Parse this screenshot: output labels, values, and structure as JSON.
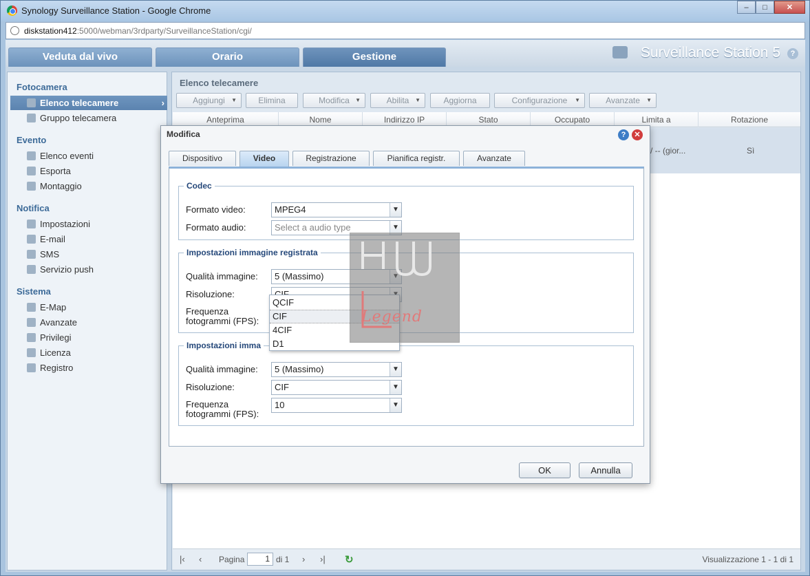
{
  "browser": {
    "title": "Synology Surveillance Station - Google Chrome",
    "url_host": "diskstation412",
    "url_rest": ":5000/webman/3rdparty/SurveillanceStation/cgi/"
  },
  "app": {
    "tabs": [
      "Veduta dal vivo",
      "Orario",
      "Gestione"
    ],
    "active_tab": "Gestione",
    "brand": "Surveillance Station 5"
  },
  "sidebar": {
    "sections": [
      {
        "title": "Fotocamera",
        "items": [
          {
            "label": "Elenco telecamere",
            "icon": "camera-list-icon",
            "active": true
          },
          {
            "label": "Gruppo telecamera",
            "icon": "camera-group-icon"
          }
        ]
      },
      {
        "title": "Evento",
        "items": [
          {
            "label": "Elenco eventi",
            "icon": "event-list-icon"
          },
          {
            "label": "Esporta",
            "icon": "export-icon"
          },
          {
            "label": "Montaggio",
            "icon": "montage-icon"
          }
        ]
      },
      {
        "title": "Notifica",
        "items": [
          {
            "label": "Impostazioni",
            "icon": "wrench-icon"
          },
          {
            "label": "E-mail",
            "icon": "email-icon"
          },
          {
            "label": "SMS",
            "icon": "sms-icon"
          },
          {
            "label": "Servizio push",
            "icon": "push-icon"
          }
        ]
      },
      {
        "title": "Sistema",
        "items": [
          {
            "label": "E-Map",
            "icon": "emap-icon"
          },
          {
            "label": "Avanzate",
            "icon": "advanced-icon"
          },
          {
            "label": "Privilegi",
            "icon": "users-icon"
          },
          {
            "label": "Licenza",
            "icon": "key-icon"
          },
          {
            "label": "Registro",
            "icon": "log-book-icon"
          }
        ]
      }
    ]
  },
  "main": {
    "title": "Elenco telecamere",
    "toolbar": [
      "Aggiungi",
      "Elimina",
      "Modifica",
      "Abilita",
      "Aggiorna",
      "Configurazione",
      "Avanzate"
    ],
    "columns": [
      "Anteprima",
      "Nome",
      "Indirizzo IP",
      "Stato",
      "Occupato",
      "Limita a",
      "Rotazione"
    ],
    "row": {
      "limita_a": "/ -- (gior...",
      "rotazione": "Sì"
    },
    "pager": {
      "page_label": "Pagina",
      "page": "1",
      "of_label": "di 1",
      "display": "Visualizzazione 1 - 1 di 1"
    }
  },
  "modal": {
    "title": "Modifica",
    "tabs": [
      "Dispositivo",
      "Video",
      "Registrazione",
      "Pianifica registr.",
      "Avanzate"
    ],
    "active_tab": "Video",
    "codec": {
      "legend": "Codec",
      "video_label": "Formato video:",
      "video_value": "MPEG4",
      "audio_label": "Formato audio:",
      "audio_placeholder": "Select a audio type"
    },
    "recorded": {
      "legend": "Impostazioni immagine registrata",
      "quality_label": "Qualità immagine:",
      "quality_value": "5 (Massimo)",
      "resolution_label": "Risoluzione:",
      "resolution_value": "CIF",
      "fps_label_1": "Frequenza",
      "fps_label_2": "fotogrammi (FPS):"
    },
    "live": {
      "legend": "Impostazioni imma",
      "quality_label": "Qualità immagine:",
      "quality_value": "5 (Massimo)",
      "resolution_label": "Risoluzione:",
      "resolution_value": "CIF",
      "fps_label_1": "Frequenza",
      "fps_label_2": "fotogrammi (FPS):",
      "fps_value": "10"
    },
    "resolution_options": [
      "QCIF",
      "CIF",
      "4CIF",
      "D1"
    ],
    "resolution_selected": "CIF",
    "ok": "OK",
    "cancel": "Annulla"
  },
  "watermark": {
    "text": "Legend"
  }
}
